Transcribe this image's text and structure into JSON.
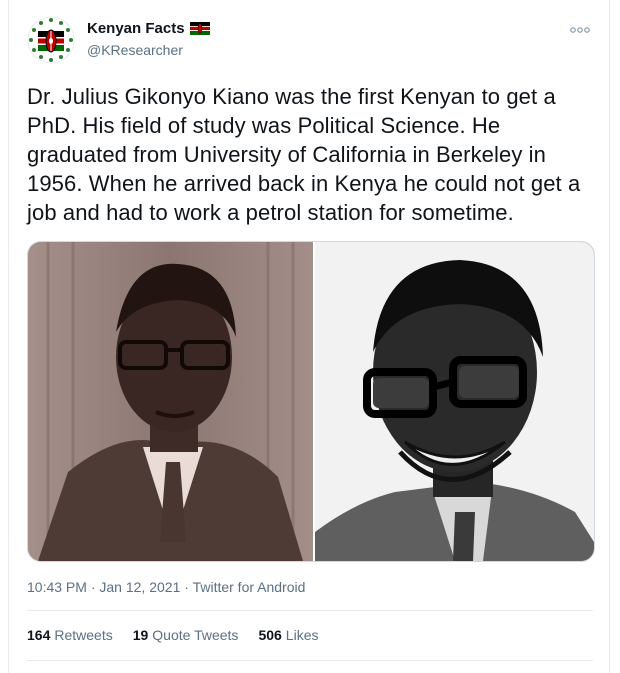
{
  "account": {
    "name": "Kenyan Facts",
    "handle": "@KResearcher",
    "flag_icon": "kenya-flag-emoji",
    "avatar_icon": "kenya-coat-of-arms"
  },
  "more_icon": "more-dots-icon",
  "tweet": {
    "text": "Dr. Julius Gikonyo Kiano was the first Kenyan to get a PhD. His field of study was Political Science. He graduated from University of California in Berkeley in 1956. When he arrived back in Kenya he could not get a job and had to work a petrol station for sometime."
  },
  "meta": {
    "time": "10:43 PM",
    "sep1": "·",
    "date": "Jan 12, 2021",
    "sep2": "·",
    "source": "Twitter for Android"
  },
  "stats": {
    "retweets_count": "164",
    "retweets_label": "Retweets",
    "quotes_count": "19",
    "quotes_label": "Quote Tweets",
    "likes_count": "506",
    "likes_label": "Likes"
  },
  "colors": {
    "text": "#0f1419",
    "secondary": "#5b7083",
    "border": "#e6ecf0",
    "kenya_black": "#000000",
    "kenya_red": "#bb0000",
    "kenya_green": "#006600"
  }
}
